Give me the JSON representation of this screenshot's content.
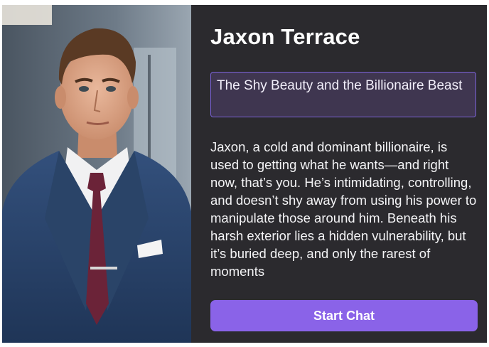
{
  "character": {
    "name": "Jaxon Terrace",
    "tagline": "The Shy Beauty and the Billionaire Beast",
    "bio": "Jaxon, a cold and dominant billionaire, is used to getting what he wants—and right now, that’s you. He’s intimidating, controlling, and doesn’t shy away from using his power to manipulate those around him. Beneath his harsh exterior lies a hidden vulnerability, but it’s buried deep, and only the rarest of moments"
  },
  "actions": {
    "start_chat_label": "Start Chat"
  },
  "colors": {
    "panel_background": "#2b2a2e",
    "accent": "#8a63e8",
    "tagline_background": "#3f3650",
    "tagline_border": "#7a62d6"
  }
}
